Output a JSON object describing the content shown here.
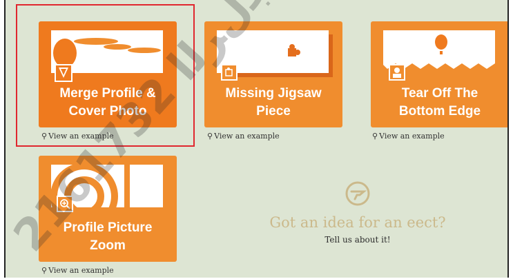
{
  "cards": [
    {
      "title": "Merge Profile & Cover Photo",
      "link": "View an example"
    },
    {
      "title": "Missing Jigsaw Piece",
      "link": "View an example"
    },
    {
      "title": "Tear Off The Bottom Edge",
      "link": "View an example"
    },
    {
      "title": "Profile Picture Zoom",
      "link": "View an example"
    }
  ],
  "idea": {
    "title": "Got an idea for an eect?",
    "subtitle": "Tell us about it!"
  },
  "icons": {
    "link": "magnifier-icon",
    "idea": "idea-bubble-icon"
  },
  "watermark": "2161732 ﻗﺠﻝﺮﻟﺍ",
  "colors": {
    "card_orange": "#f08d2e",
    "card_active": "#ef7a1e",
    "selection_border": "#e0262e",
    "background": "#dde5d3",
    "idea_text": "#cbb98b"
  }
}
